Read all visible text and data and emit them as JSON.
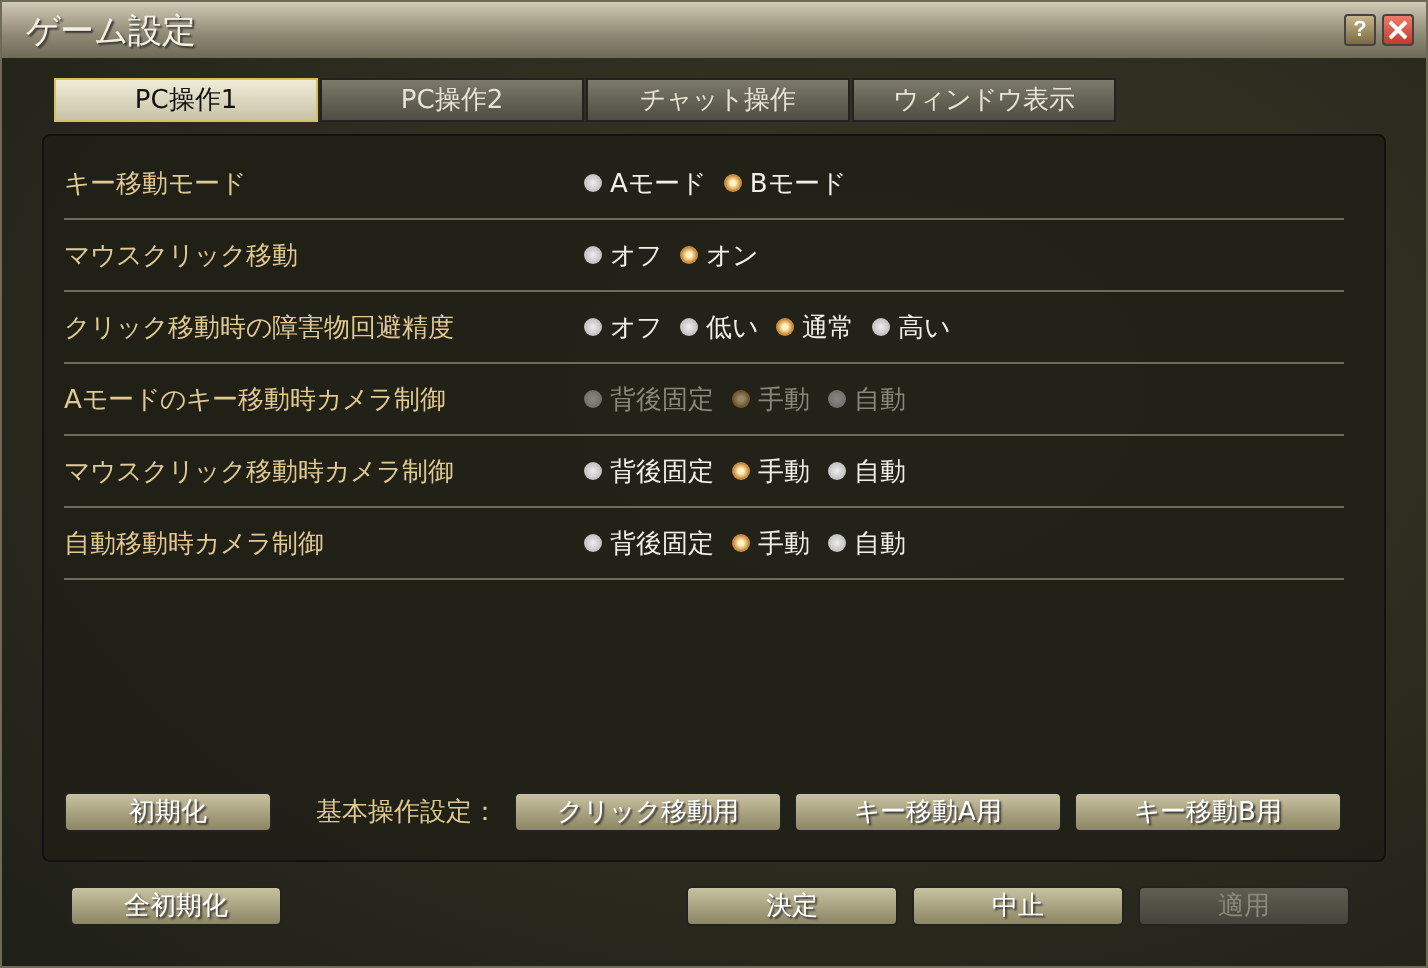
{
  "window": {
    "title": "ゲーム設定",
    "help_icon": "?"
  },
  "tabs": [
    {
      "label": "PC操作1",
      "selected": true
    },
    {
      "label": "PC操作2",
      "selected": false
    },
    {
      "label": "チャット操作",
      "selected": false
    },
    {
      "label": "ウィンドウ表示",
      "selected": false
    }
  ],
  "settings": [
    {
      "label": "キー移動モード",
      "disabled": false,
      "options": [
        {
          "label": "Aモード",
          "selected": false
        },
        {
          "label": "Bモード",
          "selected": true
        }
      ]
    },
    {
      "label": "マウスクリック移動",
      "disabled": false,
      "options": [
        {
          "label": "オフ",
          "selected": false
        },
        {
          "label": "オン",
          "selected": true
        }
      ]
    },
    {
      "label": "クリック移動時の障害物回避精度",
      "disabled": false,
      "options": [
        {
          "label": "オフ",
          "selected": false
        },
        {
          "label": "低い",
          "selected": false
        },
        {
          "label": "通常",
          "selected": true
        },
        {
          "label": "高い",
          "selected": false
        }
      ]
    },
    {
      "label": "Aモードのキー移動時カメラ制御",
      "disabled": true,
      "options": [
        {
          "label": "背後固定",
          "selected": false
        },
        {
          "label": "手動",
          "selected": true
        },
        {
          "label": "自動",
          "selected": false
        }
      ]
    },
    {
      "label": "マウスクリック移動時カメラ制御",
      "disabled": false,
      "options": [
        {
          "label": "背後固定",
          "selected": false
        },
        {
          "label": "手動",
          "selected": true
        },
        {
          "label": "自動",
          "selected": false
        }
      ]
    },
    {
      "label": "自動移動時カメラ制御",
      "disabled": false,
      "options": [
        {
          "label": "背後固定",
          "selected": false
        },
        {
          "label": "手動",
          "selected": true
        },
        {
          "label": "自動",
          "selected": false
        }
      ]
    }
  ],
  "panel_footer": {
    "reset_button": {
      "label": "初期化",
      "disabled": false
    },
    "preset_label": "基本操作設定：",
    "preset_buttons": [
      {
        "label": "クリック移動用",
        "disabled": false
      },
      {
        "label": "キー移動A用",
        "disabled": false
      },
      {
        "label": "キー移動B用",
        "disabled": false
      }
    ]
  },
  "footer": {
    "reset_all_button": {
      "label": "全初期化",
      "disabled": false
    },
    "buttons": [
      {
        "label": "決定",
        "disabled": false
      },
      {
        "label": "中止",
        "disabled": false
      },
      {
        "label": "適用",
        "disabled": true
      }
    ]
  }
}
